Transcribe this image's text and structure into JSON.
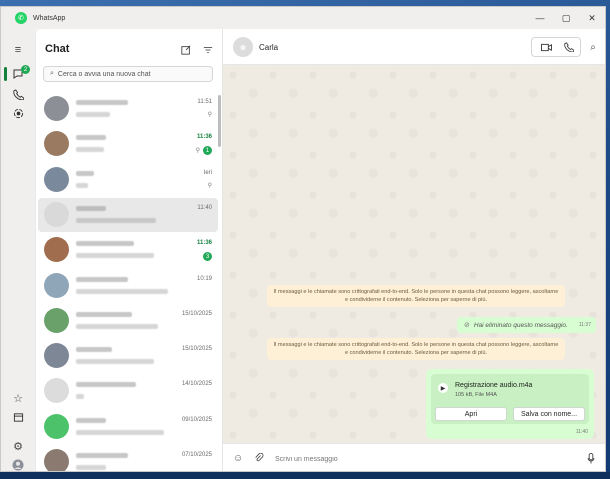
{
  "window": {
    "app_title": "WhatsApp",
    "controls": {
      "minimize": "—",
      "maximize": "▢",
      "close": "✕"
    }
  },
  "rail": {
    "chats_badge": "2",
    "icons": [
      "menu-icon",
      "chats-icon",
      "calls-icon",
      "status-icon",
      "starred-icon",
      "archive-icon",
      "settings-icon",
      "profile-icon"
    ]
  },
  "chat_list": {
    "title": "Chat",
    "search_placeholder": "Cerca o avvia una nuova chat",
    "items": [
      {
        "time": "11:51",
        "time_green": false,
        "unread": "",
        "pinned": true
      },
      {
        "time": "11:36",
        "time_green": true,
        "unread": "1",
        "pinned": true
      },
      {
        "time": "Ieri",
        "time_green": false,
        "unread": "",
        "pinned": true
      },
      {
        "time": "11:40",
        "time_green": false,
        "unread": "",
        "pinned": false,
        "selected": true
      },
      {
        "time": "11:36",
        "time_green": true,
        "unread": "3",
        "pinned": false
      },
      {
        "time": "10:19",
        "time_green": false,
        "unread": "",
        "pinned": false
      },
      {
        "time": "15/10/2025",
        "time_green": false,
        "unread": "",
        "pinned": false
      },
      {
        "time": "15/10/2025",
        "time_green": false,
        "unread": "",
        "pinned": false
      },
      {
        "time": "14/10/2025",
        "time_green": false,
        "unread": "",
        "pinned": false
      },
      {
        "time": "09/10/2025",
        "time_green": false,
        "unread": "",
        "pinned": false
      },
      {
        "time": "07/10/2025",
        "time_green": false,
        "unread": "",
        "pinned": false
      }
    ]
  },
  "conversation": {
    "contact_name": "Carla",
    "system_notice_1": "Il messaggi e le chiamate sono crittografati end-to-end. Solo le persone in questa chat possono leggere, ascoltarne e condividerne il contenuto. Seleziona per saperne di più.",
    "system_notice_2": "Il messaggi e le chiamate sono crittografati end-to-end. Solo le persone in questa chat possono leggere, ascoltarne e condividerne il contenuto. Seleziona per saperne di più.",
    "deleted_message": "Hai eliminato questo messaggio.",
    "deleted_time": "11:37",
    "file": {
      "name": "Registrazione audio.m4a",
      "meta": "105 kB, File M4A",
      "open_label": "Apri",
      "save_label": "Salva con nome...",
      "time": "11:40"
    },
    "composer_placeholder": "Scrivi un messaggio"
  },
  "colors": {
    "accent": "#1fa855",
    "outgoing_bubble": "#d9fdd3",
    "system_notice": "#fdf0d6",
    "chat_background": "#efeae2"
  }
}
